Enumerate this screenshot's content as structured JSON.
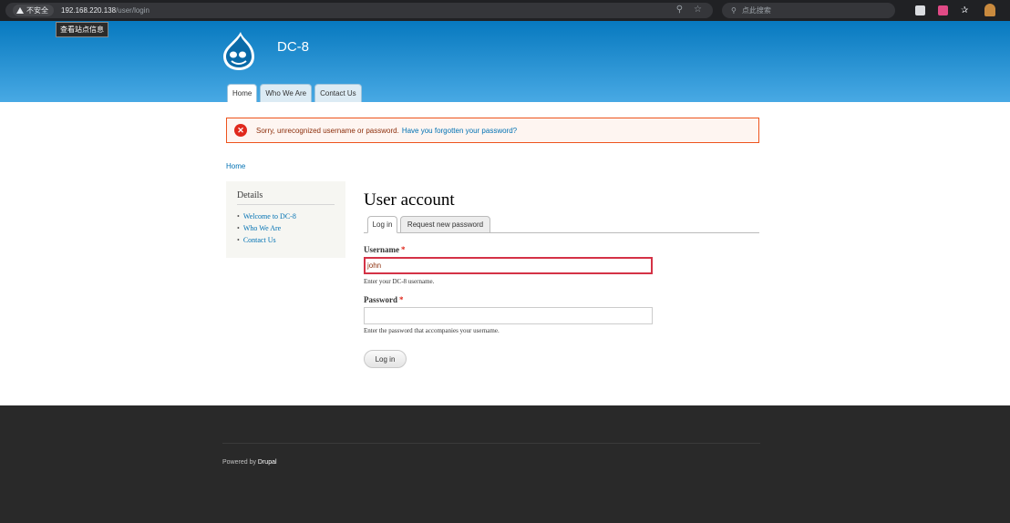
{
  "browser": {
    "security_label": "不安全",
    "url_host": "192.168.220.138",
    "url_path": "/user/login",
    "search_placeholder": "点此搜索",
    "tooltip": "查看站点信息"
  },
  "site": {
    "name": "DC-8",
    "tabs": [
      {
        "label": "Home",
        "active": true
      },
      {
        "label": "Who We Are",
        "active": false
      },
      {
        "label": "Contact Us",
        "active": false
      }
    ]
  },
  "message": {
    "text": "Sorry, unrecognized username or password.",
    "link": "Have you forgotten your password?"
  },
  "breadcrumb": "Home",
  "sidebar": {
    "title": "Details",
    "items": [
      "Welcome to DC-8",
      "Who We Are",
      "Contact Us"
    ]
  },
  "main": {
    "title": "User account",
    "tabs": [
      "Log in",
      "Request new password"
    ],
    "username_label": "Username",
    "username_value": "john",
    "username_desc": "Enter your DC-8 username.",
    "password_label": "Password",
    "password_value": "",
    "password_desc": "Enter the password that accompanies your username.",
    "required_mark": "*",
    "submit_label": "Log in"
  },
  "footer": {
    "prefix": "Powered by",
    "link": "Drupal"
  },
  "colors": {
    "header_top": "#0779bf",
    "header_bottom": "#48a9e4",
    "link": "#0071b3",
    "error": "#e0281c",
    "footer_bg": "#292929"
  }
}
